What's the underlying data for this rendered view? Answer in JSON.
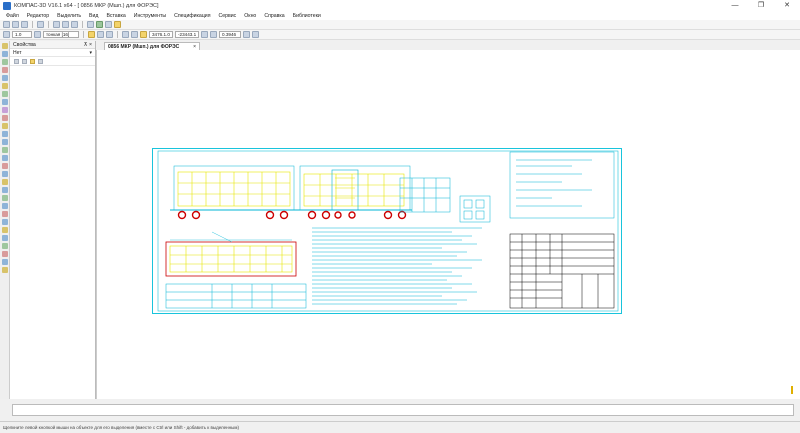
{
  "window": {
    "title": "КОМПАС-3D V16.1 x64 - [ 0856 МКР (Мшп.) для ФОРЭС]",
    "minimize": "—",
    "maximize": "❐",
    "close": "✕"
  },
  "menu": [
    "Файл",
    "Редактор",
    "Выделить",
    "Вид",
    "Вставка",
    "Инструменты",
    "Спецификация",
    "Сервис",
    "Окно",
    "Справка",
    "Библиотеки"
  ],
  "toolbar": {
    "scale_value": "1.0",
    "line_style": "тонкая [16]",
    "coord_x": "3476.1.0",
    "coord_y": "-23443.1",
    "zoom": "0.3946"
  },
  "properties": {
    "title": "Свойства",
    "object_label": "Нет",
    "pin_icon": "pin-icon",
    "close_icon": "close-icon"
  },
  "document_tab": {
    "label": "0856 МКР (Мшп.) для ФОРЭС",
    "close": "×"
  },
  "status_text": "Щелкните левой кнопкой мыши на объекте для его выделения (вместе с Ctrl или Shift - добавить к выделенным)",
  "colors": {
    "drawing": "#00b5d6",
    "frame": "#18c4dc",
    "hatch": "#e6e600",
    "title_block": "#000000",
    "wheels": "#cc0000"
  }
}
